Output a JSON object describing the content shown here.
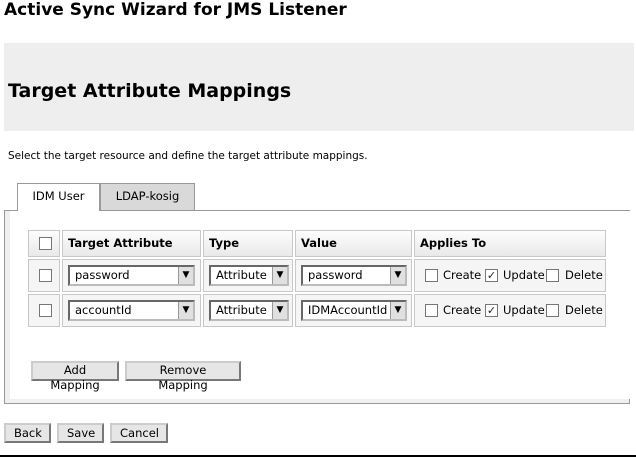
{
  "page": {
    "title": "Active Sync Wizard for JMS Listener"
  },
  "section": {
    "title": "Target Attribute Mappings",
    "instructions": "Select the target resource and define the target attribute mappings."
  },
  "tabs": [
    {
      "label": "IDM User",
      "active": true
    },
    {
      "label": "LDAP-kosig",
      "active": false
    }
  ],
  "table": {
    "headers": {
      "target_attribute": "Target Attribute",
      "type": "Type",
      "value": "Value",
      "applies_to": "Applies To"
    },
    "rows": [
      {
        "selected": false,
        "target_attribute": "password",
        "type": "Attribute",
        "value": "password",
        "create": false,
        "update": true,
        "delete": false
      },
      {
        "selected": false,
        "target_attribute": "accountId",
        "type": "Attribute",
        "value": "IDMAccountId",
        "create": false,
        "update": true,
        "delete": false
      }
    ],
    "applies_labels": {
      "create": "Create",
      "update": "Update",
      "delete": "Delete"
    }
  },
  "panel_buttons": {
    "add_mapping": "Add Mapping",
    "remove_mapping": "Remove Mapping"
  },
  "footer_buttons": {
    "back": "Back",
    "save": "Save",
    "cancel": "Cancel"
  },
  "icons": {
    "dropdown": "chevron-down-icon",
    "checkmark": "check-icon"
  }
}
